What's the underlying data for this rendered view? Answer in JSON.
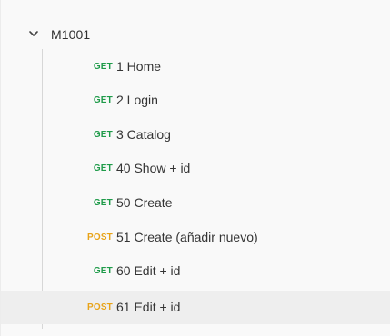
{
  "folder": {
    "name": "M1001",
    "expanded": true,
    "icon": "chevron-down-icon"
  },
  "requests": [
    {
      "method": "GET",
      "name": "1 Home"
    },
    {
      "method": "GET",
      "name": "2 Login"
    },
    {
      "method": "GET",
      "name": "3 Catalog"
    },
    {
      "method": "GET",
      "name": "40 Show + id"
    },
    {
      "method": "GET",
      "name": "50 Create"
    },
    {
      "method": "POST",
      "name": "51 Create (añadir nuevo)"
    },
    {
      "method": "GET",
      "name": "60 Edit + id"
    },
    {
      "method": "POST",
      "name": "61 Edit + id",
      "selected": true
    }
  ],
  "colors": {
    "get": "#1f9b4a",
    "post": "#e8a318",
    "selected_background": "#eeeeee"
  }
}
